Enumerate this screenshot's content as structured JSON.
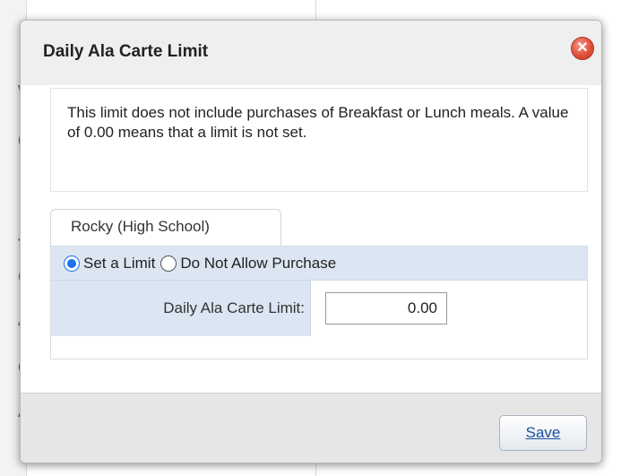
{
  "background": {
    "glyphs": [
      "W",
      "d",
      "J",
      "c",
      "A",
      "c",
      "A"
    ]
  },
  "dialog": {
    "title": "Daily Ala Carte Limit",
    "close_icon": "close-icon",
    "info_text": "This limit does not include purchases of Breakfast or Lunch meals. A value of 0.00 means that a limit is not set.",
    "tab_label": "Rocky (High School)",
    "radio_options": [
      {
        "label": "Set a Limit",
        "checked": true
      },
      {
        "label": "Do Not Allow Purchase",
        "checked": false
      }
    ],
    "limit_label": "Daily Ala Carte Limit:",
    "limit_value": "0.00",
    "save_label": "Save"
  },
  "colors": {
    "accent_blue": "#1a73e8",
    "row_highlight": "#dce6f2",
    "close_red": "#e0503c",
    "link_blue": "#1c4f9c"
  }
}
